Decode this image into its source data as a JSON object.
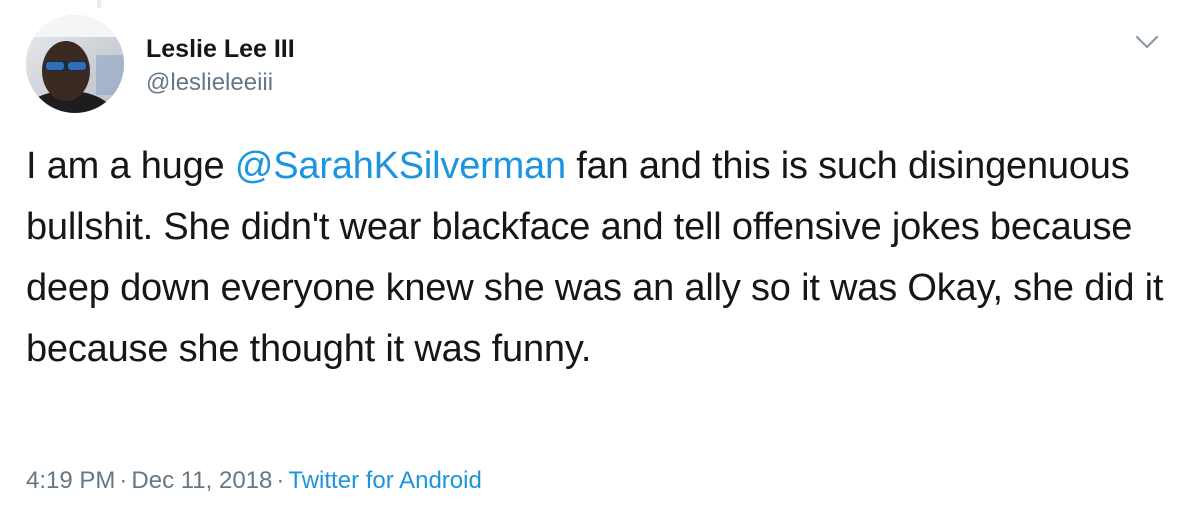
{
  "author": {
    "display_name": "Leslie Lee III",
    "handle": "@leslieleeiii"
  },
  "tweet": {
    "text_before": "I am a huge ",
    "mention": "@SarahKSilverman",
    "text_after": " fan and this is such disingenuous bullshit. She didn't wear blackface and tell offensive jokes because deep down everyone knew she was an ally so it was Okay, she did it because she thought it was funny."
  },
  "meta": {
    "time": "4:19 PM",
    "separator": "·",
    "date": "Dec 11, 2018",
    "source": "Twitter for Android"
  },
  "icons": {
    "caret": "chevron-down-icon"
  },
  "colors": {
    "link": "#1b95e0",
    "secondary_text": "#657786",
    "primary_text": "#14171a"
  }
}
